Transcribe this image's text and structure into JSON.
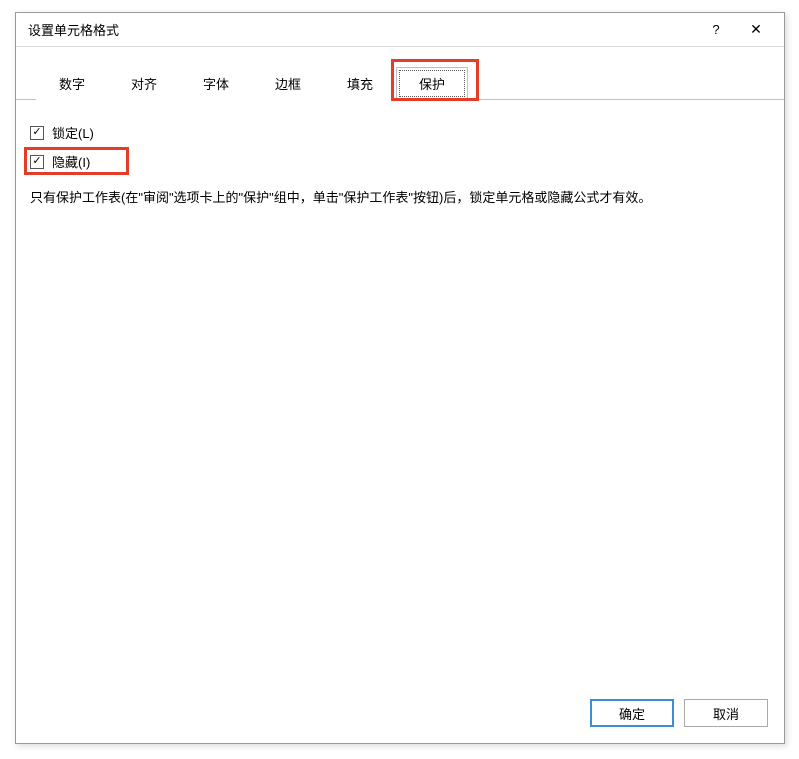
{
  "dialog": {
    "title": "设置单元格格式",
    "help_label": "?",
    "close_label": "✕"
  },
  "tabs": {
    "items": [
      {
        "label": "数字"
      },
      {
        "label": "对齐"
      },
      {
        "label": "字体"
      },
      {
        "label": "边框"
      },
      {
        "label": "填充"
      },
      {
        "label": "保护"
      }
    ],
    "active_index": 5
  },
  "protection": {
    "locked": {
      "label": "锁定(L)",
      "checked": true
    },
    "hidden": {
      "label": "隐藏(I)",
      "checked": true
    },
    "description": "只有保护工作表(在\"审阅\"选项卡上的\"保护\"组中，单击\"保护工作表\"按钮)后，锁定单元格或隐藏公式才有效。"
  },
  "footer": {
    "ok_label": "确定",
    "cancel_label": "取消"
  }
}
